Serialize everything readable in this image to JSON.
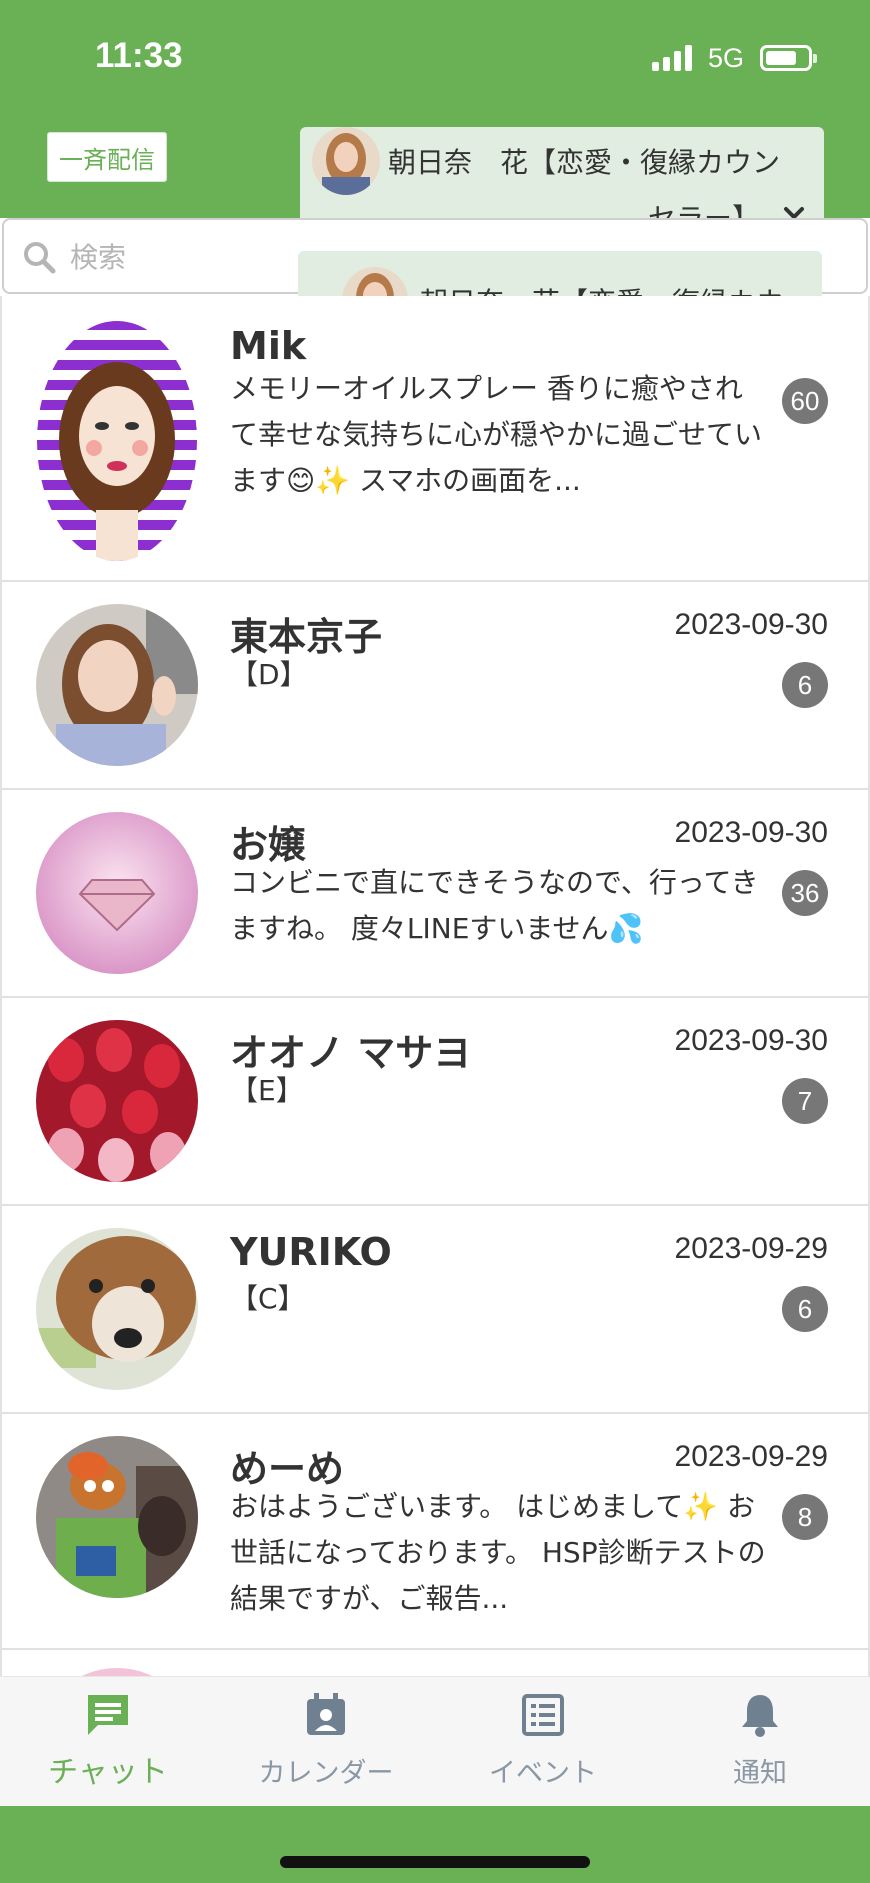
{
  "status_bar": {
    "time": "11:33",
    "network": "5G"
  },
  "header": {
    "broadcast_label": "一斉配信",
    "account_name_line1": "朝日奈　花【恋愛・復縁カウン",
    "account_name_line2": "セラー】",
    "account_option": "朝日奈　花【恋愛・復縁カウ"
  },
  "search": {
    "placeholder": "検索"
  },
  "chats": [
    {
      "name": "Mik",
      "date": "",
      "preview": "メモリーオイルスプレー 香りに癒やされて幸せな気持ちに心が穏やかに過ごせています😊✨ スマホの画面を...",
      "badge": "60"
    },
    {
      "name": "東本京子",
      "date": "2023-09-30",
      "preview": "【D】",
      "badge": "6"
    },
    {
      "name": "お嬢",
      "date": "2023-09-30",
      "preview": "コンビニで直にできそうなので、行ってきますね。 度々LINEすいません💦",
      "badge": "36"
    },
    {
      "name": "オオノ マサヨ",
      "date": "2023-09-30",
      "preview": "【E】",
      "badge": "7"
    },
    {
      "name": "YURIKO",
      "date": "2023-09-29",
      "preview": "【C】",
      "badge": "6"
    },
    {
      "name": "めーめ",
      "date": "2023-09-29",
      "preview": "おはようございます。 はじめまして✨ お世話になっております。 HSP診断テストの結果ですが、ご報告...",
      "badge": "8"
    }
  ],
  "bottom_nav": {
    "chat": "チャット",
    "calendar": "カレンダー",
    "event": "イベント",
    "notice": "通知"
  },
  "colors": {
    "brand_green": "#6ab055",
    "dropdown_bg": "#e0ede0",
    "badge_gray": "#777777",
    "nav_gray": "#8a97a5"
  },
  "icons": [
    "search-icon",
    "chevron-down-icon",
    "chat-icon",
    "calendar-icon",
    "event-list-icon",
    "bell-icon"
  ]
}
